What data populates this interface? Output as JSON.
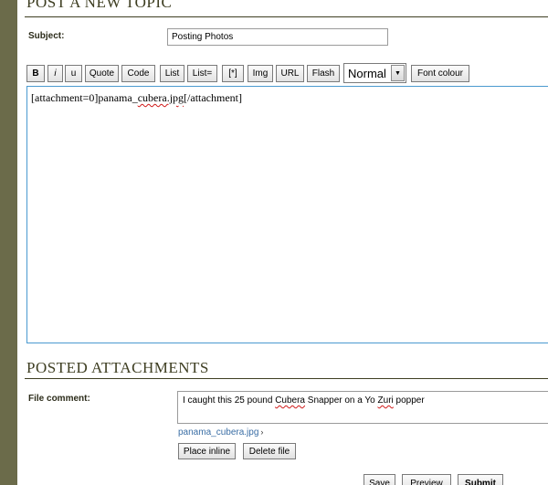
{
  "page": {
    "title": "POST A NEW TOPIC",
    "subject_label": "Subject:",
    "subject_value": "Posting Photos"
  },
  "toolbar": {
    "bold": "B",
    "italic": "i",
    "underline": "u",
    "quote": "Quote",
    "code": "Code",
    "list": "List",
    "list_ordered": "List=",
    "list_item": "[*]",
    "img": "Img",
    "url": "URL",
    "flash": "Flash",
    "font_size": "Normal",
    "font_colour": "Font colour"
  },
  "editor": {
    "text_before": "[attachment=0]panama_",
    "text_misspelled": "cubera.jpg",
    "text_after": "[/attachment]"
  },
  "attachments": {
    "title": "POSTED ATTACHMENTS",
    "comment_label": "File comment:",
    "comment_parts": [
      "I caught this 25 pound ",
      "Cubera",
      " Snapper on a Yo ",
      "Zuri",
      " popper"
    ],
    "file_name": "panama_cubera.jpg",
    "place_inline": "Place inline",
    "delete_file": "Delete file"
  },
  "footer": {
    "save": "Save",
    "preview": "Preview",
    "submit": "Submit"
  },
  "colors": {
    "sidebar": "#6b6b4a",
    "heading": "#3e3e22",
    "editor_border": "#4a9ad0",
    "link": "#3a6ea5"
  }
}
